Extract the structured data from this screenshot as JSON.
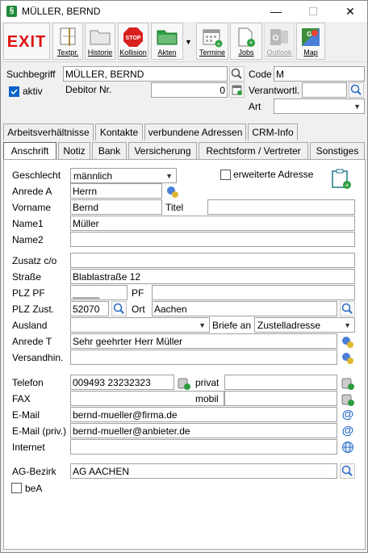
{
  "window": {
    "title": "MÜLLER, BERND",
    "minimize": "—",
    "maximize": "☐",
    "close": "✕"
  },
  "toolbar": {
    "exit": "EXIT",
    "textpr": "Textpr.",
    "historie": "Historie",
    "kollision": "Kollision",
    "kollision_icon_text": "STOP",
    "akten": "Akten",
    "termine": "Termine",
    "jobs": "Jobs",
    "outlook": "Outlook",
    "map": "Map"
  },
  "header": {
    "suchbegriff_label": "Suchbegriff",
    "suchbegriff_value": "MÜLLER, BERND",
    "code_label": "Code",
    "code_value": "M",
    "aktiv_label": "aktiv",
    "debitor_label": "Debitor Nr.",
    "debitor_value": "0",
    "verantw_label": "Verantwortl.",
    "verantw_value": "",
    "art_label": "Art",
    "art_value": ""
  },
  "tabs_row1": [
    "Arbeitsverhältnisse",
    "Kontakte",
    "verbundene Adressen",
    "CRM-Info"
  ],
  "tabs_row2": [
    "Anschrift",
    "Notiz",
    "Bank",
    "Versicherung",
    "Rechtsform / Vertreter",
    "Sonstiges"
  ],
  "form": {
    "geschlecht_label": "Geschlecht",
    "geschlecht_value": "männlich",
    "erweiterte_label": "erweiterte Adresse",
    "anrede_a_label": "Anrede A",
    "anrede_a_value": "Herrn",
    "vorname_label": "Vorname",
    "vorname_value": "Bernd",
    "titel_label": "Titel",
    "titel_value": "",
    "name1_label": "Name1",
    "name1_value": "Müller",
    "name2_label": "Name2",
    "name2_value": "",
    "zusatz_label": "Zusatz  c/o",
    "zusatz_value": "",
    "strasse_label": "Straße",
    "strasse_value": "Blablastraße 12",
    "plz_pf_label": "PLZ PF",
    "plz_pf_value": "_____",
    "pf_label": "PF",
    "pf_value": "",
    "plz_zust_label": "PLZ Zust.",
    "plz_zust_value": "52070",
    "ort_label": "Ort",
    "ort_value": "Aachen",
    "ausland_label": "Ausland",
    "ausland_value": "",
    "briefe_label": "Briefe an",
    "briefe_value": "Zustelladresse",
    "anrede_t_label": "Anrede T",
    "anrede_t_value": "Sehr geehrter Herr Müller",
    "versandhin_label": "Versandhin.",
    "versandhin_value": "",
    "telefon_label": "Telefon",
    "telefon_value": "009493 23232323",
    "privat_label": "privat",
    "privat_value": "",
    "fax_label": "FAX",
    "fax_value": "",
    "mobil_label": "mobil",
    "mobil_value": "",
    "email_label": "E-Mail",
    "email_value": "bernd-mueller@firma.de",
    "email_priv_label": "E-Mail (priv.)",
    "email_priv_value": "bernd-mueller@anbieter.de",
    "internet_label": "Internet",
    "internet_value": "",
    "agbezirk_label": "AG-Bezirk",
    "agbezirk_value": "AG AACHEN",
    "bea_label": "beA"
  }
}
